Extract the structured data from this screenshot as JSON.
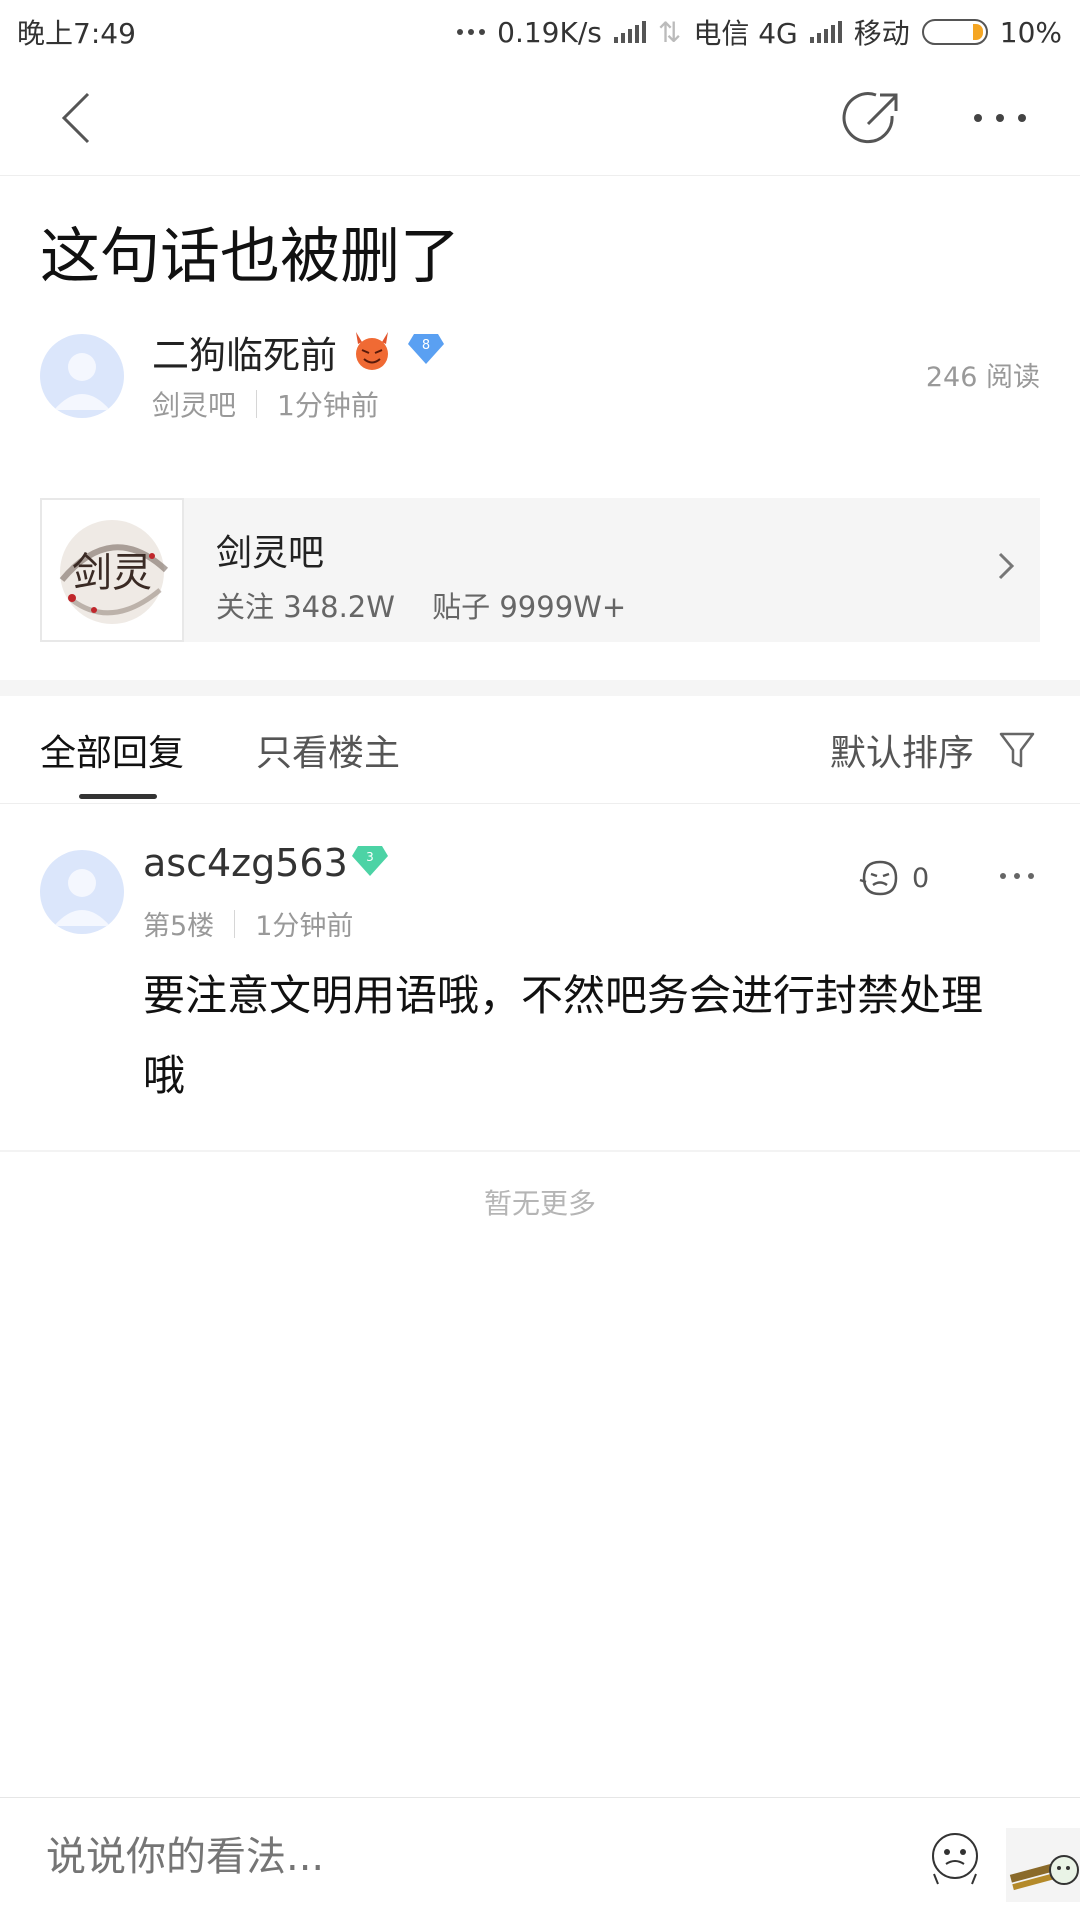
{
  "status_bar": {
    "time": "晚上7:49",
    "net_speed": "0.19K/s",
    "carrier1": "电信 4G",
    "carrier2": "移动",
    "battery": "10%"
  },
  "nav": {
    "back_icon": "chevron-left-icon",
    "share_icon": "share-icon",
    "more_icon": "more-horizontal-icon"
  },
  "post": {
    "title": "这句话也被删了",
    "author": "二狗临死前",
    "author_level": "8",
    "forum": "剑灵吧",
    "time": "1分钟前",
    "reads": "246 阅读"
  },
  "forum_card": {
    "name": "剑灵吧",
    "follow": "关注 348.2W",
    "posts": "贴子 9999W+",
    "logo_text": "剑灵"
  },
  "tabs": {
    "all": "全部回复",
    "op_only": "只看楼主",
    "sort": "默认排序"
  },
  "reply": {
    "username": "asc4zg563",
    "level": "3",
    "floor": "第5楼",
    "time": "1分钟前",
    "likes": "0",
    "text": "要注意文明用语哦，不然吧务会进行封禁处理哦"
  },
  "footer": {
    "no_more": "暂无更多"
  },
  "comment_bar": {
    "placeholder": "说说你的看法..."
  },
  "colors": {
    "avatar_bg": "#dbe6fb",
    "level_blue": "#5aa0f2",
    "level_green": "#4cd3a5",
    "battery_orange": "#f5a623"
  }
}
